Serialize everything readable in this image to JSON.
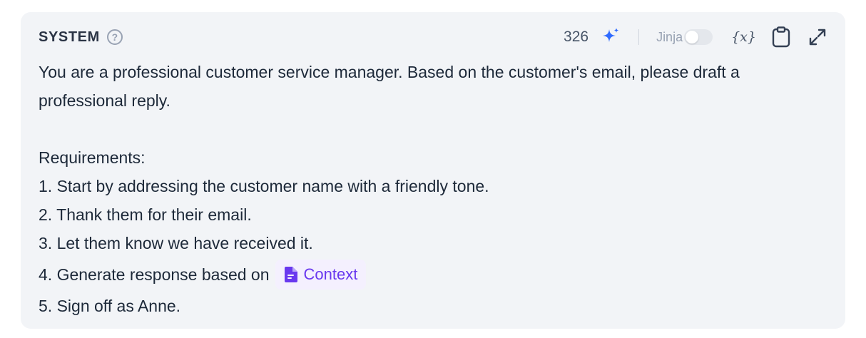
{
  "header": {
    "title": "SYSTEM",
    "help_icon": "?",
    "token_count": "326",
    "jinja_label": "Jinja",
    "jinja_enabled": false,
    "variable_icon_text": "{x}"
  },
  "icons": {
    "help": "help-circle-icon",
    "sparkle": "sparkle-icon",
    "variable": "variable-icon",
    "clipboard": "clipboard-icon",
    "expand": "expand-icon",
    "document": "document-icon"
  },
  "colors": {
    "panel_bg": "#f2f4f7",
    "sparkle": "#2f6bff",
    "context_chip_text": "#6938ef",
    "context_chip_bg": "#f4f0fe"
  },
  "prompt": {
    "intro": "You are a professional customer service manager. Based on the customer's email, please draft a professional reply.",
    "requirements_heading": "Requirements:",
    "item1": "1. Start by addressing the customer name with a friendly tone.",
    "item2": "2. Thank them for their email.",
    "item3": "3. Let them know we have received it.",
    "item4_prefix": "4. Generate response based on",
    "context_chip_label": "Context",
    "item5": "5. Sign off as Anne."
  }
}
